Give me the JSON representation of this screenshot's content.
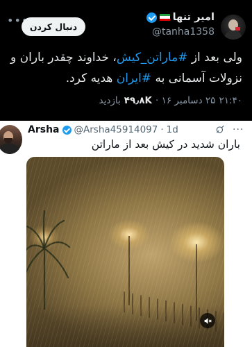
{
  "top_tweet": {
    "display_name": "امیر تنها",
    "handle": "@tanha1358",
    "follow_label": "دنبال کردن",
    "text_parts": [
      "ولی بعد از ",
      "#ماراتن_کیش",
      "، خداوند چقدر باران و نزولات آسمانی به ",
      "#ایران",
      " هدیه کرد."
    ],
    "time": "۲۱:۴۰",
    "date": "۲۵ دسامبر ۱۶ ·",
    "views_count": "۴۹٫۸K",
    "views_label": "بازدید"
  },
  "quoted_tweet": {
    "display_name": "Arsha",
    "handle": "@Arsha45914097",
    "dot": "·",
    "time": "1d",
    "text": "باران شدید در کیش بعد از ماراتن"
  },
  "icons": {
    "more": "more-dots-icon",
    "verified": "verified-badge-icon",
    "flag": "iran-flag-icon",
    "grok": "grok-icon",
    "mute": "speaker-muted-icon"
  },
  "colors": {
    "link": "#1d9bf0",
    "verified": "#1d9bf0",
    "dark_bg": "#000000",
    "muted_dark": "#8b98a5",
    "muted_light": "#536471"
  }
}
